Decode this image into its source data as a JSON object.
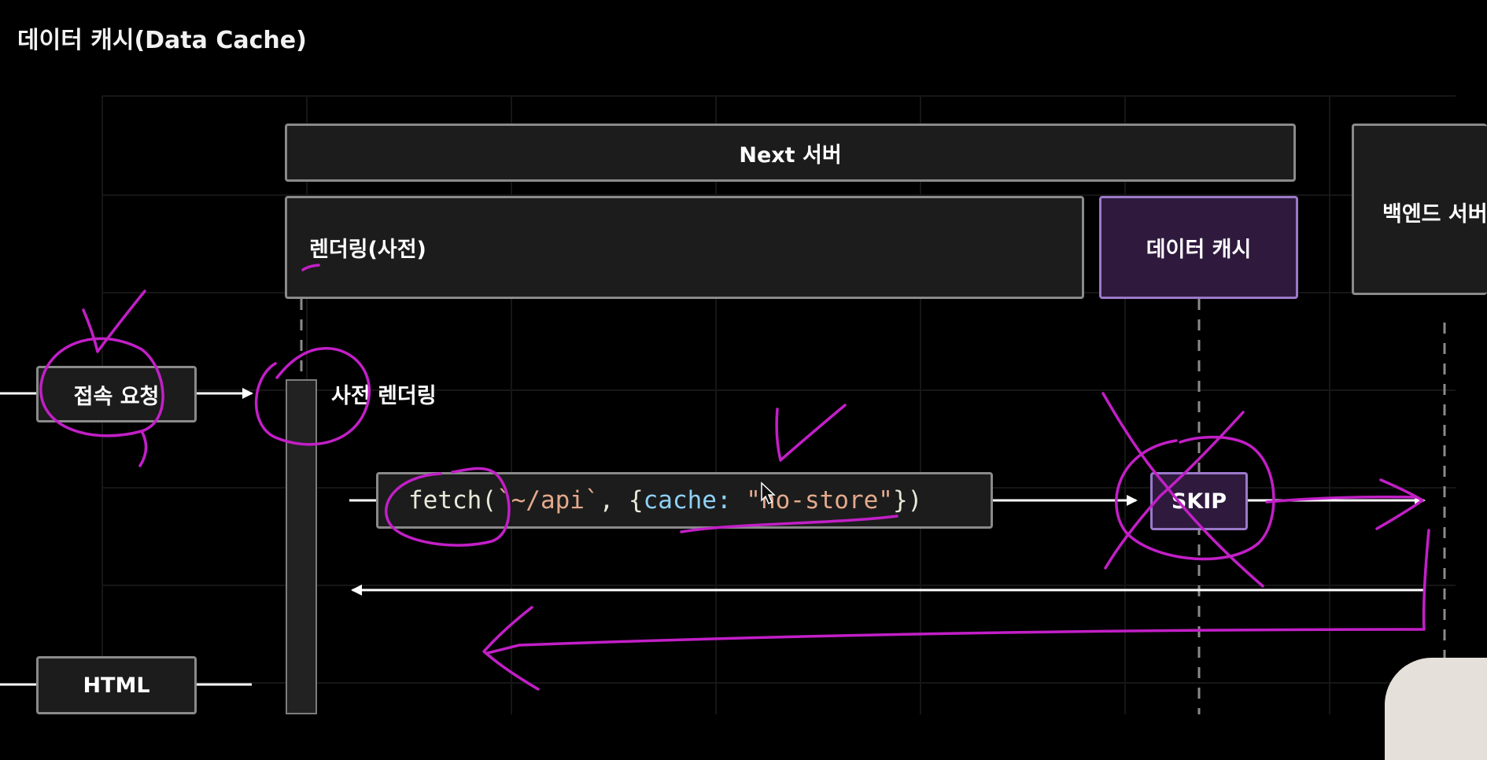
{
  "title": "데이터 캐시(Data Cache)",
  "boxes": {
    "next_server": "Next 서버",
    "rendering": "렌더링(사전)",
    "data_cache": "데이터 캐시",
    "backend": "백엔드 서버",
    "request": "접속 요청",
    "html": "HTML",
    "skip": "SKIP"
  },
  "labels": {
    "prerender": "사전 렌더링"
  },
  "code": {
    "fn": "fetch(",
    "arg": "`~/api`",
    "mid": ", {",
    "key": "cache:",
    "space": " ",
    "val": "\"no-store\"",
    "end": "})"
  },
  "colors": {
    "background": "#000000",
    "box_fill": "#1c1c1c",
    "box_border": "#8a8a8a",
    "cache_fill": "#2f1a3e",
    "cache_border": "#9b79c9",
    "annotation": "#c21fc7"
  }
}
